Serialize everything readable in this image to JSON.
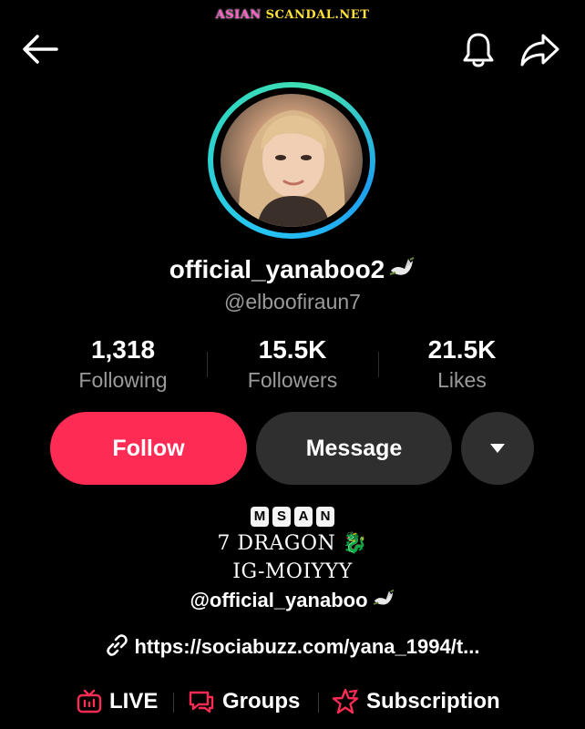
{
  "watermark": {
    "part1": "ASIAN",
    "part2": "SCANDAL.NET"
  },
  "profile": {
    "username": "official_yanaboo2",
    "handle": "@elboofiraun7"
  },
  "stats": [
    {
      "value": "1,318",
      "label": "Following"
    },
    {
      "value": "15.5K",
      "label": "Followers"
    },
    {
      "value": "21.5K",
      "label": "Likes"
    }
  ],
  "actions": {
    "follow": "Follow",
    "message": "Message"
  },
  "bio": {
    "badge": [
      "M",
      "S",
      "A",
      "N"
    ],
    "line1": "7 DRAGON 🐉",
    "line2": "IG-MOIYYY",
    "tag": "@official_yanaboo",
    "link": "https://sociabuzz.com/yana_1994/t..."
  },
  "bottom": {
    "live": "LIVE",
    "groups": "Groups",
    "subscription": "Subscription"
  },
  "colors": {
    "accent": "#fe2c55",
    "ring": "#27c4f5",
    "button_bg": "#2f2f2f"
  },
  "icons": [
    "back-arrow-icon",
    "bell-icon",
    "share-icon",
    "chevron-down-icon",
    "link-icon",
    "live-tv-icon",
    "chat-icon",
    "star-icon",
    "dove-icon"
  ]
}
